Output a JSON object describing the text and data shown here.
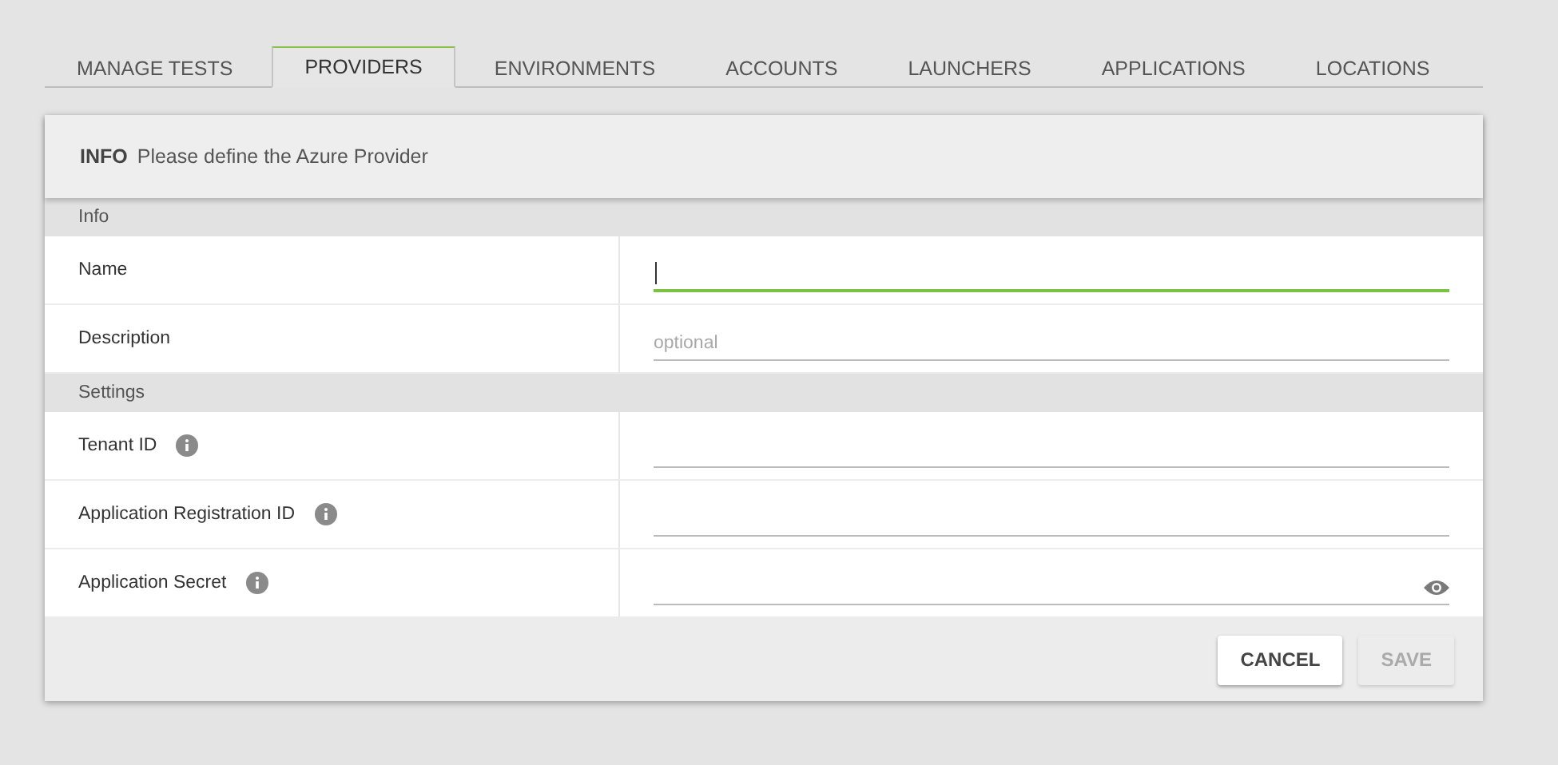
{
  "tabs": [
    {
      "label": "MANAGE TESTS",
      "selected": false
    },
    {
      "label": "PROVIDERS",
      "selected": true
    },
    {
      "label": "ENVIRONMENTS",
      "selected": false
    },
    {
      "label": "ACCOUNTS",
      "selected": false
    },
    {
      "label": "LAUNCHERS",
      "selected": false
    },
    {
      "label": "APPLICATIONS",
      "selected": false
    },
    {
      "label": "LOCATIONS",
      "selected": false
    }
  ],
  "header": {
    "title": "INFO",
    "message": "Please define the Azure Provider"
  },
  "sections": [
    {
      "title": "Info",
      "fields": [
        {
          "label": "Name",
          "info": false,
          "focused": true,
          "kind": "text"
        },
        {
          "label": "Description",
          "info": false,
          "focused": false,
          "kind": "text",
          "placeholder": "optional"
        }
      ]
    },
    {
      "title": "Settings",
      "fields": [
        {
          "label": "Tenant ID",
          "info": true,
          "focused": false,
          "kind": "text"
        },
        {
          "label": "Application Registration ID",
          "info": true,
          "focused": false,
          "kind": "text"
        },
        {
          "label": "Application Secret",
          "info": true,
          "focused": false,
          "kind": "password"
        }
      ]
    }
  ],
  "buttons": [
    {
      "label": "CANCEL",
      "disabled": false
    },
    {
      "label": "SAVE",
      "disabled": true
    }
  ]
}
